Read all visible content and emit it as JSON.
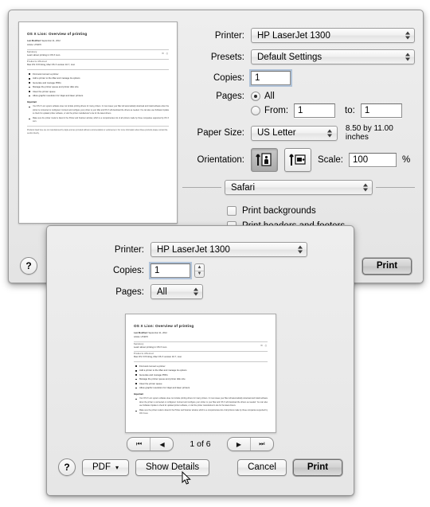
{
  "expanded_dialog": {
    "printer": {
      "label": "Printer:",
      "value": "HP LaserJet 1300"
    },
    "presets": {
      "label": "Presets:",
      "value": "Default Settings"
    },
    "copies": {
      "label": "Copies:",
      "value": "1"
    },
    "pages": {
      "label": "Pages:",
      "all_label": "All",
      "from_label": "From:",
      "from_value": "1",
      "to_label": "to:",
      "to_value": "1",
      "selected": "All"
    },
    "paper_size": {
      "label": "Paper Size:",
      "value": "US Letter",
      "dimensions": "8.50 by 11.00 inches"
    },
    "orientation": {
      "label": "Orientation:",
      "selected": "portrait"
    },
    "scale": {
      "label": "Scale:",
      "value": "100",
      "unit": "%"
    },
    "app_panel": {
      "value": "Safari"
    },
    "checkboxes": [
      {
        "label": "Print backgrounds",
        "checked": false
      },
      {
        "label": "Print headers and footers",
        "checked": false
      }
    ],
    "buttons": {
      "help": "?",
      "print": "Print"
    },
    "nav": {
      "first": "⏮",
      "prev": "◀",
      "next": "▶",
      "last": "⏭"
    }
  },
  "simple_dialog": {
    "printer": {
      "label": "Printer:",
      "value": "HP LaserJet 1300"
    },
    "copies": {
      "label": "Copies:",
      "value": "1"
    },
    "pages": {
      "label": "Pages:",
      "value": "All"
    },
    "pagenav": {
      "first": "⏮",
      "prev": "◀",
      "next": "▶",
      "last": "⏭",
      "counter": "1 of 6"
    },
    "buttons": {
      "help": "?",
      "pdf": "PDF",
      "pdf_arrow": "▾",
      "show_details": "Show Details",
      "cancel": "Cancel",
      "print": "Print"
    }
  },
  "document_preview": {
    "title": "OS X Lion: Overview of printing",
    "meta_label": "Last Modified:",
    "meta_value": "September 21, 2012",
    "meta_article": "Article: HT4670",
    "summary_label": "Summary",
    "summary_text": "Learn about printing in OS X Lion.",
    "products_label": "Products Affected",
    "products_text": "Mac OS X Printing, Mac OS X version 10.7, Lion",
    "icons": "✉ ⎙",
    "bullets": [
      "Find and connect a printer",
      "Add a printer to the Mac and manage its options",
      "Generate and manage PDFs",
      "Manage the printer queue and printer disk size",
      "Clear the printer queue",
      "Allow graphic resolution for inkjet and laser printers"
    ],
    "important_label": "Important",
    "paragraphs": [
      "Your OS X Lion system software does not include printing drivers for many printers. In most cases your Mac will automatically download and install software when the printer is connected or configured. Connect and configure your printer to your Mac and OS X will download the drivers as needed. You can also use Software Update to check for updated printer software, or visit the printer manufacturer's site for the latest drivers.",
      "Make sure the printer model is listed in the Printer and Scanner window, which is a comprehensive list of all printers made by those companies supported by OS X Lion."
    ],
    "footer": "Products listed here are not manufactured by Apple and are provided without recommendation or endorsement. For more information about these products please contact the vendor directly."
  }
}
